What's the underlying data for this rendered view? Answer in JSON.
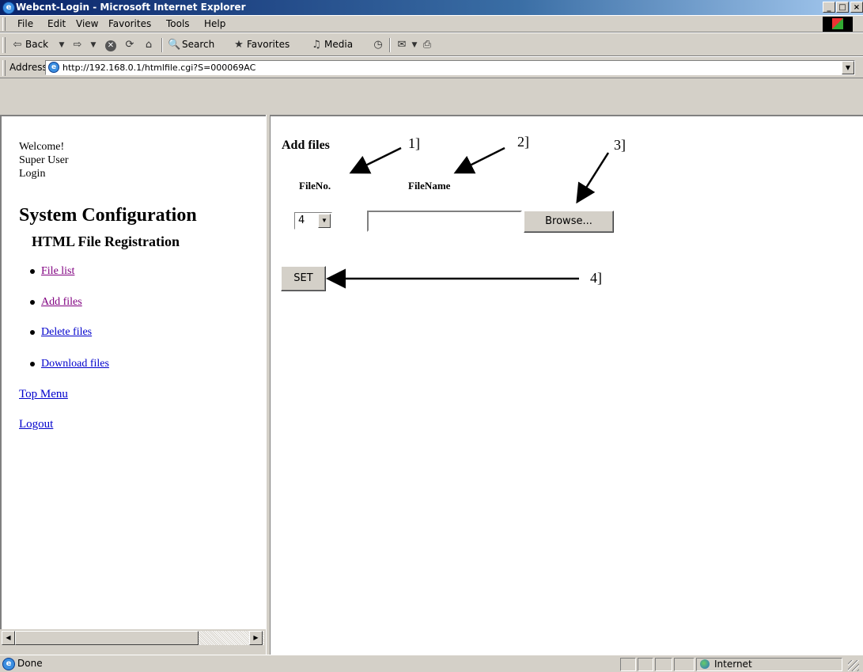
{
  "window": {
    "title": "Webcnt-Login - Microsoft Internet Explorer"
  },
  "menubar": {
    "items": [
      "File",
      "Edit",
      "View",
      "Favorites",
      "Tools",
      "Help"
    ]
  },
  "toolbar": {
    "back": "Back",
    "search": "Search",
    "favorites": "Favorites",
    "media": "Media"
  },
  "address": {
    "label": "Address",
    "url": "http://192.168.0.1/htmlfile.cgi?S=000069AC"
  },
  "sidebar": {
    "welcome": "Welcome!",
    "user": "Super User",
    "login": "Login",
    "heading": "System Configuration",
    "subheading": "HTML File Registration",
    "items": [
      "File list",
      "Add files",
      "Delete files",
      "Download files"
    ],
    "top_menu": "Top Menu",
    "logout": "Logout"
  },
  "main": {
    "title": "Add files",
    "col_fileno": "FileNo.",
    "col_filename": "FileName",
    "fileno_value": "4",
    "filename_value": "",
    "browse_label": "Browse...",
    "set_label": "SET"
  },
  "annotations": {
    "a1": "1]",
    "a2": "2]",
    "a3": "3]",
    "a4": "4]"
  },
  "status": {
    "text": "Done",
    "zone": "Internet"
  }
}
